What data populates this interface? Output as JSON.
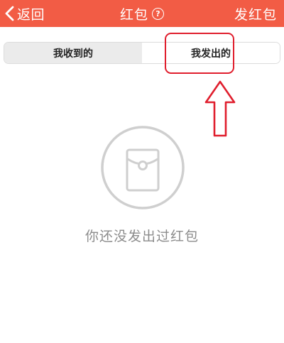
{
  "navbar": {
    "back_label": "返回",
    "title": "红包",
    "help_symbol": "?",
    "action_label": "发红包",
    "background_color": "#f25c45"
  },
  "tabs": [
    {
      "label": "我收到的",
      "selected": true
    },
    {
      "label": "我发出的",
      "selected": false
    }
  ],
  "empty_state": {
    "icon": "red-envelope-icon",
    "message": "你还没发出过红包"
  },
  "annotation": {
    "color": "#e01e2d",
    "arrow_icon": "arrow-up-icon"
  }
}
